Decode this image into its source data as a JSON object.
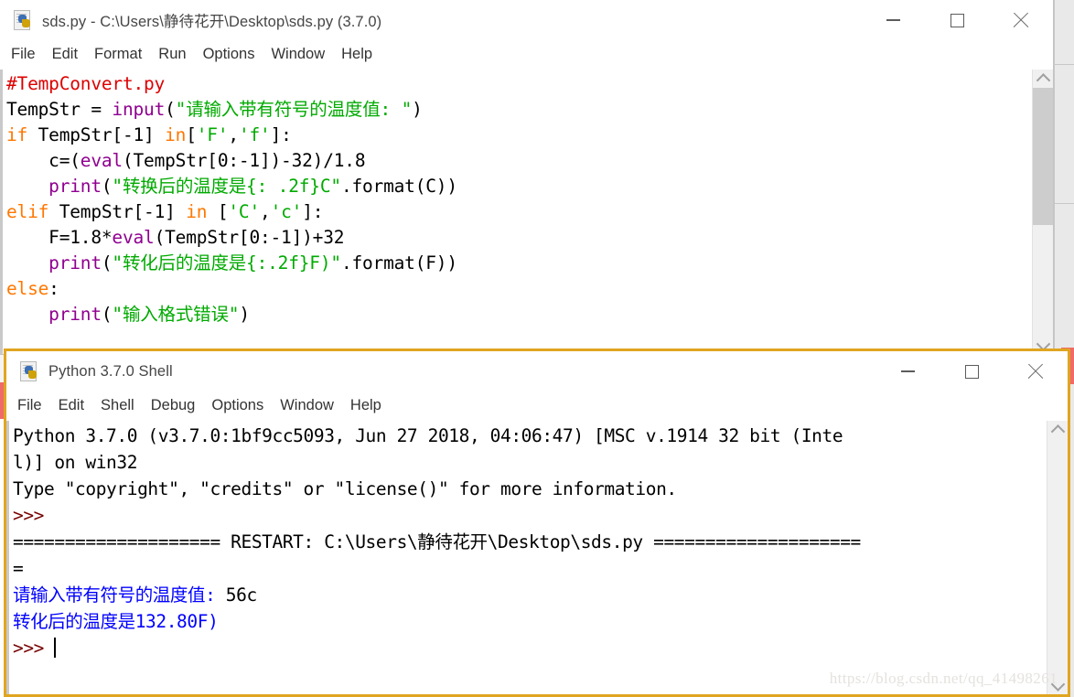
{
  "editor_window": {
    "title": "sds.py - C:\\Users\\静待花开\\Desktop\\sds.py (3.7.0)",
    "icon": "python-file-icon",
    "menu": [
      "File",
      "Edit",
      "Format",
      "Run",
      "Options",
      "Window",
      "Help"
    ],
    "buttons": {
      "minimize": "minimize-icon",
      "maximize": "maximize-icon",
      "close": "close-icon"
    },
    "code": [
      [
        {
          "t": "#TempConvert.py",
          "c": "comment"
        }
      ],
      [
        {
          "t": "TempStr = ",
          "c": "plain"
        },
        {
          "t": "input",
          "c": "builtin"
        },
        {
          "t": "(",
          "c": "plain"
        },
        {
          "t": "\"请输入带有符号的温度值: \"",
          "c": "str"
        },
        {
          "t": ")",
          "c": "plain"
        }
      ],
      [
        {
          "t": "if",
          "c": "kw"
        },
        {
          "t": " TempStr[-1] ",
          "c": "plain"
        },
        {
          "t": "in",
          "c": "kw"
        },
        {
          "t": "[",
          "c": "plain"
        },
        {
          "t": "'F'",
          "c": "str"
        },
        {
          "t": ",",
          "c": "plain"
        },
        {
          "t": "'f'",
          "c": "str"
        },
        {
          "t": "]:",
          "c": "plain"
        }
      ],
      [
        {
          "t": "    c=(",
          "c": "plain"
        },
        {
          "t": "eval",
          "c": "builtin"
        },
        {
          "t": "(TempStr[0:-1])-32)/1.8",
          "c": "plain"
        }
      ],
      [
        {
          "t": "    ",
          "c": "plain"
        },
        {
          "t": "print",
          "c": "builtin"
        },
        {
          "t": "(",
          "c": "plain"
        },
        {
          "t": "\"转换后的温度是{: .2f}C\"",
          "c": "str"
        },
        {
          "t": ".format(C))",
          "c": "plain"
        }
      ],
      [
        {
          "t": "elif",
          "c": "kw"
        },
        {
          "t": " TempStr[-1] ",
          "c": "plain"
        },
        {
          "t": "in",
          "c": "kw"
        },
        {
          "t": " [",
          "c": "plain"
        },
        {
          "t": "'C'",
          "c": "str"
        },
        {
          "t": ",",
          "c": "plain"
        },
        {
          "t": "'c'",
          "c": "str"
        },
        {
          "t": "]:",
          "c": "plain"
        }
      ],
      [
        {
          "t": "    F=1.8*",
          "c": "plain"
        },
        {
          "t": "eval",
          "c": "builtin"
        },
        {
          "t": "(TempStr[0:-1])+32",
          "c": "plain"
        }
      ],
      [
        {
          "t": "    ",
          "c": "plain"
        },
        {
          "t": "print",
          "c": "builtin"
        },
        {
          "t": "(",
          "c": "plain"
        },
        {
          "t": "\"转化后的温度是{:.2f}F)\"",
          "c": "str"
        },
        {
          "t": ".format(F))",
          "c": "plain"
        }
      ],
      [
        {
          "t": "else",
          "c": "kw"
        },
        {
          "t": ":",
          "c": "plain"
        }
      ],
      [
        {
          "t": "    ",
          "c": "plain"
        },
        {
          "t": "print",
          "c": "builtin"
        },
        {
          "t": "(",
          "c": "plain"
        },
        {
          "t": "\"输入格式错误\"",
          "c": "str"
        },
        {
          "t": ")",
          "c": "plain"
        }
      ]
    ]
  },
  "shell_window": {
    "title": "Python 3.7.0 Shell",
    "icon": "python-file-icon",
    "menu": [
      "File",
      "Edit",
      "Shell",
      "Debug",
      "Options",
      "Window",
      "Help"
    ],
    "buttons": {
      "minimize": "minimize-icon",
      "maximize": "maximize-icon",
      "close": "close-icon"
    },
    "output": [
      [
        {
          "t": "Python 3.7.0 (v3.7.0:1bf9cc5093, Jun 27 2018, 04:06:47) [MSC v.1914 32 bit (Inte",
          "c": "plain"
        }
      ],
      [
        {
          "t": "l)] on win32",
          "c": "plain"
        }
      ],
      [
        {
          "t": "Type \"copyright\", \"credits\" or \"license()\" for more information.",
          "c": "plain"
        }
      ],
      [
        {
          "t": ">>>",
          "c": "prompt"
        }
      ],
      [
        {
          "t": "==================== RESTART: C:\\Users\\静待花开\\Desktop\\sds.py ====================",
          "c": "plain"
        }
      ],
      [
        {
          "t": "=",
          "c": "plain"
        }
      ],
      [
        {
          "t": "请输入带有符号的温度值: ",
          "c": "out"
        },
        {
          "t": "56c",
          "c": "plain"
        }
      ],
      [
        {
          "t": "转化后的温度是132.80F)",
          "c": "out"
        }
      ],
      [
        {
          "t": ">>> ",
          "c": "prompt"
        },
        {
          "t": "",
          "c": "caret"
        }
      ]
    ]
  },
  "watermark": "https://blog.csdn.net/qq_41498261",
  "colors": {
    "comment": "#dd0000",
    "keyword": "#ff7700",
    "builtin": "#900090",
    "string": "#00aa00",
    "prompt": "#770000",
    "output": "#0000ff",
    "active_border": "#e0a520"
  }
}
